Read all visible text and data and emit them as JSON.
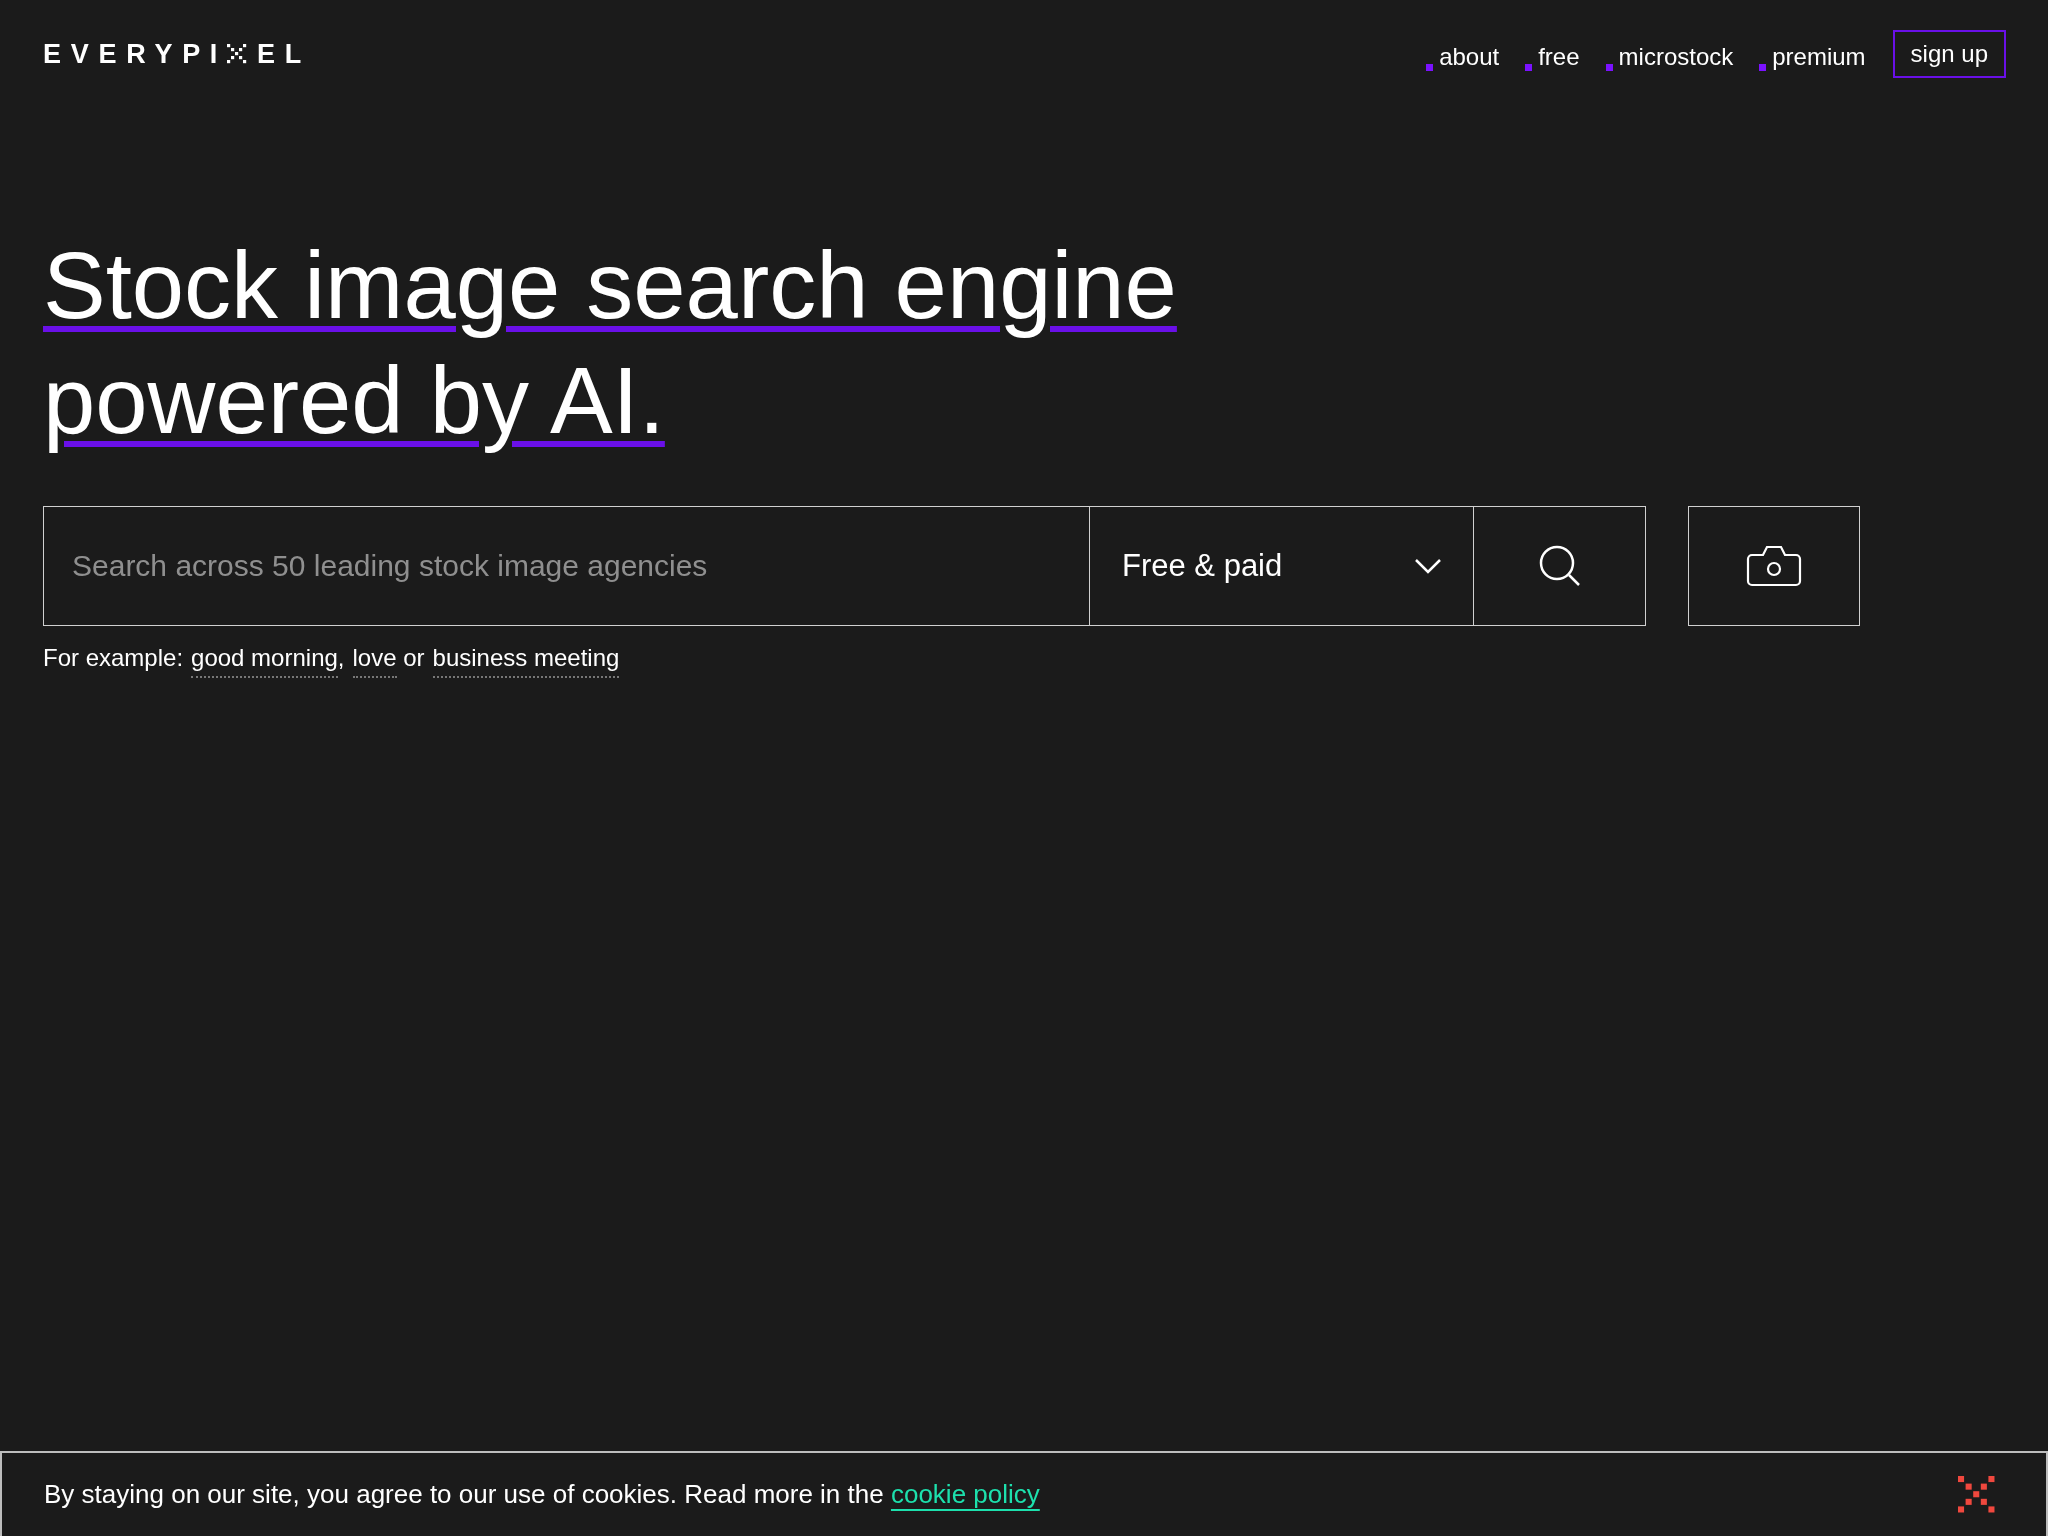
{
  "logo": {
    "before": "EVERYPI",
    "after": "EL"
  },
  "nav": {
    "links": [
      {
        "label": "about"
      },
      {
        "label": "free"
      },
      {
        "label": "microstock"
      },
      {
        "label": "premium"
      }
    ],
    "signup": "sign up"
  },
  "headline": [
    "Stock image search engine",
    "powered by AI."
  ],
  "search": {
    "placeholder": "Search across 50 leading stock image agencies",
    "filter": "Free & paid"
  },
  "examples": {
    "intro": "For example:",
    "items": [
      {
        "text": "good morning",
        "sep": ","
      },
      {
        "text": "love",
        "sep": " or"
      },
      {
        "text": "business meeting"
      }
    ]
  },
  "cookie": {
    "text": "By staying on our site, you agree to our use of cookies. Read more in the",
    "link": "cookie policy"
  }
}
